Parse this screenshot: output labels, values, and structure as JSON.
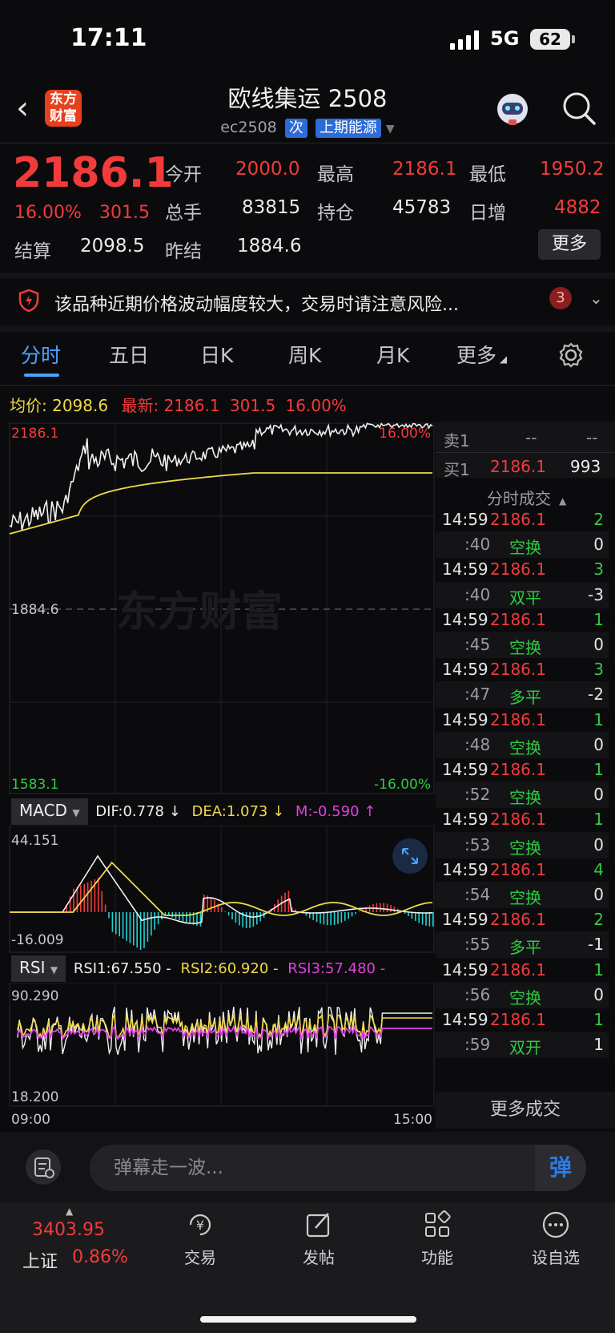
{
  "status": {
    "time": "17:11",
    "network": "5G",
    "battery": "62"
  },
  "header": {
    "logo": "东方财富",
    "title": "欧线集运 2508",
    "code": "ec2508",
    "tag1": "次",
    "tag2": "上期能源"
  },
  "quote": {
    "price": "2186.1",
    "pct": "16.00%",
    "chg": "301.5",
    "open_label": "今开",
    "open": "2000.0",
    "high_label": "最高",
    "high": "2186.1",
    "low_label": "最低",
    "low": "1950.2",
    "volume_label": "总手",
    "volume": "83815",
    "oi_label": "持仓",
    "oi": "45783",
    "daily_inc_label": "日增",
    "daily_inc": "4882",
    "settle_label": "结算",
    "settle": "2098.5",
    "prev_settle_label": "昨结",
    "prev_settle": "1884.6",
    "more_label": "更多"
  },
  "risk": {
    "text": "该品种近期价格波动幅度较大，交易时请注意风险...",
    "count": "3"
  },
  "tabs": [
    {
      "label": "分时"
    },
    {
      "label": "五日"
    },
    {
      "label": "日K"
    },
    {
      "label": "周K"
    },
    {
      "label": "月K"
    },
    {
      "label": "更多"
    }
  ],
  "chart_info": {
    "avg_label": "均价:",
    "avg": "2098.6",
    "latest_label": "最新:",
    "latest": "2186.1",
    "latest_chg": "301.5",
    "latest_pct": "16.00%"
  },
  "main_chart": {
    "y_top": "2186.1",
    "y_mid": "1884.6",
    "y_bottom": "1583.1",
    "pct_top": "16.00%",
    "pct_bottom": "-16.00%",
    "watermark": "东方财富"
  },
  "macd": {
    "name": "MACD",
    "dif": "DIF:0.778 ↓",
    "dea": "DEA:1.073 ↓",
    "m": "M:-0.590 ↑",
    "y_top": "44.151",
    "y_bottom": "-16.009"
  },
  "rsi": {
    "name": "RSI",
    "rsi1": "RSI1:67.550 -",
    "rsi2": "RSI2:60.920 -",
    "rsi3": "RSI3:57.480 -",
    "y_top": "90.290",
    "y_bottom": "18.200",
    "x_start": "09:00",
    "x_end": "15:00"
  },
  "orderbook": {
    "sell_label": "卖1",
    "sell_price": "--",
    "sell_vol": "--",
    "buy_label": "买1",
    "buy_price": "2186.1",
    "buy_vol": "993",
    "ticks_label": "分时成交"
  },
  "ticks": [
    {
      "time": "14:59",
      "price": "2186.1",
      "vol": "2"
    },
    {
      "time": ":40",
      "type": "空换",
      "vol": "0"
    },
    {
      "time": "14:59",
      "price": "2186.1",
      "vol": "3"
    },
    {
      "time": ":40",
      "type": "双平",
      "vol": "-3"
    },
    {
      "time": "14:59",
      "price": "2186.1",
      "vol": "1"
    },
    {
      "time": ":45",
      "type": "空换",
      "vol": "0"
    },
    {
      "time": "14:59",
      "price": "2186.1",
      "vol": "3"
    },
    {
      "time": ":47",
      "type": "多平",
      "vol": "-2"
    },
    {
      "time": "14:59",
      "price": "2186.1",
      "vol": "1"
    },
    {
      "time": ":48",
      "type": "空换",
      "vol": "0"
    },
    {
      "time": "14:59",
      "price": "2186.1",
      "vol": "1"
    },
    {
      "time": ":52",
      "type": "空换",
      "vol": "0"
    },
    {
      "time": "14:59",
      "price": "2186.1",
      "vol": "1"
    },
    {
      "time": ":53",
      "type": "空换",
      "vol": "0"
    },
    {
      "time": "14:59",
      "price": "2186.1",
      "vol": "4"
    },
    {
      "time": ":54",
      "type": "空换",
      "vol": "0"
    },
    {
      "time": "14:59",
      "price": "2186.1",
      "vol": "2"
    },
    {
      "time": ":55",
      "type": "多平",
      "vol": "-1"
    },
    {
      "time": "14:59",
      "price": "2186.1",
      "vol": "1"
    },
    {
      "time": ":56",
      "type": "空换",
      "vol": "0"
    },
    {
      "time": "14:59",
      "price": "2186.1",
      "vol": "1"
    },
    {
      "time": ":59",
      "type": "双开",
      "vol": "1"
    }
  ],
  "more_ticks_label": "更多成交",
  "danmu": {
    "placeholder": "弹幕走一波...",
    "button": "弹"
  },
  "nav": {
    "index_value": "3403.95",
    "index_name": "上证",
    "index_pct": "0.86%",
    "trade": "交易",
    "post": "发帖",
    "func": "功能",
    "watch": "设自选"
  },
  "colors": {
    "up": "#f23b3b",
    "down": "#2ecc40",
    "accent": "#4aa3ff",
    "avg_line": "#f1d94a"
  }
}
